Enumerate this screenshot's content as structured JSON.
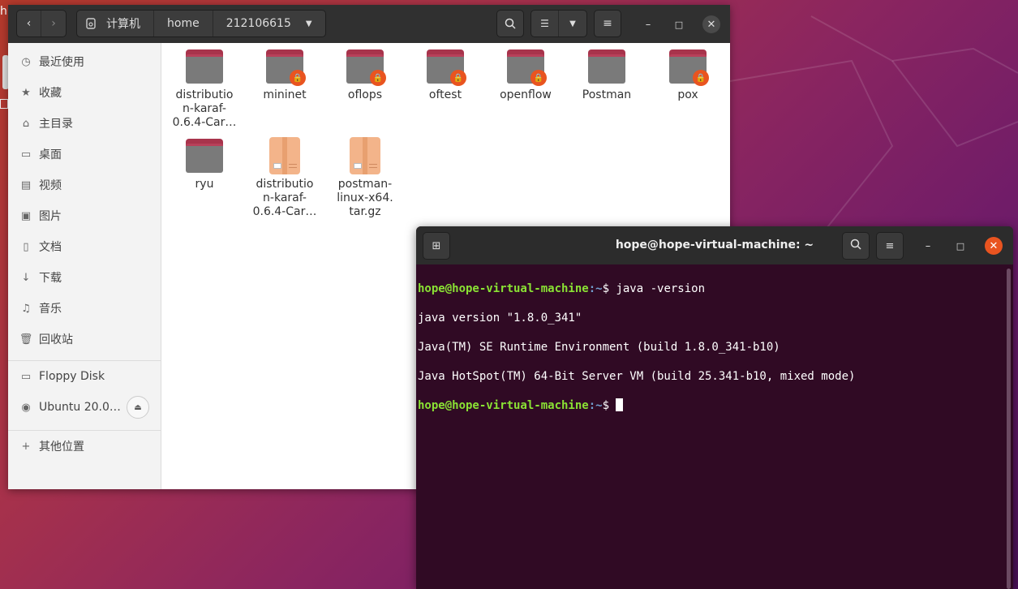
{
  "desktop": {
    "corner_label": "h"
  },
  "files": {
    "path_root": "计算机",
    "path_segments": [
      "home",
      "212106615"
    ],
    "sidebar": {
      "items": [
        {
          "label": "最近使用",
          "icon": "clock-icon"
        },
        {
          "label": "收藏",
          "icon": "star-icon"
        },
        {
          "label": "主目录",
          "icon": "home-icon"
        },
        {
          "label": "桌面",
          "icon": "desktop-icon"
        },
        {
          "label": "视频",
          "icon": "video-icon"
        },
        {
          "label": "图片",
          "icon": "picture-icon"
        },
        {
          "label": "文档",
          "icon": "document-icon"
        },
        {
          "label": "下载",
          "icon": "download-icon"
        },
        {
          "label": "音乐",
          "icon": "music-icon"
        },
        {
          "label": "回收站",
          "icon": "trash-icon"
        }
      ],
      "devices": [
        {
          "label": "Floppy Disk",
          "icon": "floppy-icon"
        },
        {
          "label": "Ubuntu 20.0…",
          "icon": "disc-icon"
        }
      ],
      "other": {
        "label": "其他位置",
        "icon": "plus-icon"
      }
    },
    "items": [
      {
        "name": "distributio\nn-karaf-\n0.6.4-Car…",
        "type": "folder",
        "locked": false
      },
      {
        "name": "mininet",
        "type": "folder",
        "locked": true
      },
      {
        "name": "oflops",
        "type": "folder",
        "locked": true
      },
      {
        "name": "oftest",
        "type": "folder",
        "locked": true
      },
      {
        "name": "openflow",
        "type": "folder",
        "locked": true
      },
      {
        "name": "Postman",
        "type": "folder",
        "locked": false
      },
      {
        "name": "pox",
        "type": "folder",
        "locked": true
      },
      {
        "name": "ryu",
        "type": "folder",
        "locked": false
      },
      {
        "name": "distributio\nn-karaf-\n0.6.4-Car…",
        "type": "archive",
        "locked": false
      },
      {
        "name": "postman-\nlinux-x64.\ntar.gz",
        "type": "archive",
        "locked": false
      }
    ]
  },
  "terminal": {
    "title": "hope@hope-virtual-machine: ~",
    "prompt_user": "hope@hope-virtual-machine",
    "prompt_path": ":~",
    "prompt_suffix": "$ ",
    "command": "java -version",
    "output": [
      "java version \"1.8.0_341\"",
      "Java(TM) SE Runtime Environment (build 1.8.0_341-b10)",
      "Java HotSpot(TM) 64-Bit Server VM (build 25.341-b10, mixed mode)"
    ]
  },
  "colors": {
    "accent": "#e95420",
    "terminal_bg": "#300a24",
    "prompt_user": "#8ae234",
    "prompt_path": "#729fcf"
  }
}
